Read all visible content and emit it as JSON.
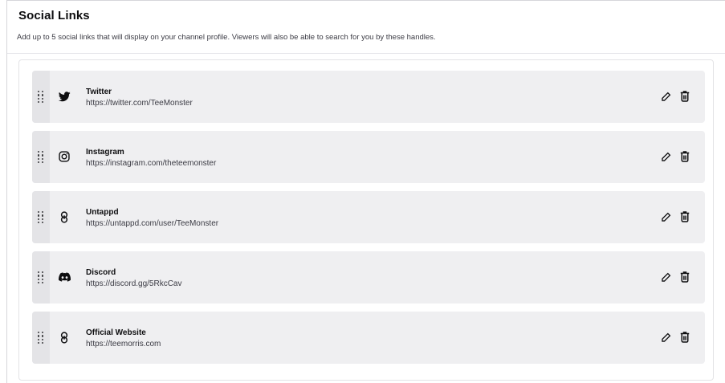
{
  "header": {
    "title": "Social Links",
    "description": "Add up to 5 social links that will display on your channel profile. Viewers will also be able to search for you by these handles."
  },
  "links": [
    {
      "name": "Twitter",
      "url": "https://twitter.com/TeeMonster",
      "icon": "twitter-icon"
    },
    {
      "name": "Instagram",
      "url": "https://instagram.com/theteemonster",
      "icon": "instagram-icon"
    },
    {
      "name": "Untappd",
      "url": "https://untappd.com/user/TeeMonster",
      "icon": "link-icon"
    },
    {
      "name": "Discord",
      "url": "https://discord.gg/5RkcCav",
      "icon": "discord-icon"
    },
    {
      "name": "Official Website",
      "url": "https://teemorris.com",
      "icon": "link-icon"
    }
  ],
  "icons": {
    "drag": "drag-handle-icon",
    "edit": "pencil-icon",
    "delete": "trash-icon"
  }
}
